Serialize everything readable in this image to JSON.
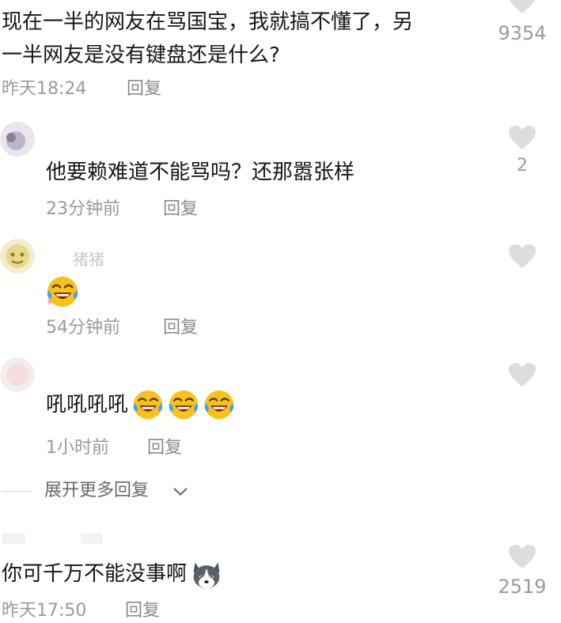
{
  "comments": [
    {
      "text_line1": "现在一半的网友在骂国宝，我就搞不懂了，另",
      "text_line2": "一半网友是没有键盘还是什么?",
      "time": "昨天18:24",
      "reply_label": "回复",
      "likes": "9354"
    },
    {
      "text": "他要赖难道不能骂吗？还那嚣张样",
      "time": "23分钟前",
      "reply_label": "回复",
      "likes": "2"
    },
    {
      "username": "猪猪",
      "time": "54分钟前",
      "reply_label": "回复",
      "emoji": "laughing-crying-emoji"
    },
    {
      "text": "吼吼吼吼",
      "time": "1小时前",
      "reply_label": "回复",
      "emoji": "laughing-crying-emoji"
    },
    {
      "expand_label": "展开更多回复"
    },
    {
      "text": "你可千万不能没事啊",
      "time": "昨天17:50",
      "reply_label": "回复",
      "likes": "2519",
      "emoji": "husky-dog-emoji"
    }
  ],
  "colors": {
    "text": "#161616",
    "meta": "#9a9a9a",
    "heart": "#dddddd",
    "divider": "#d8d8d8",
    "emoji_face": "#f7c21b"
  }
}
